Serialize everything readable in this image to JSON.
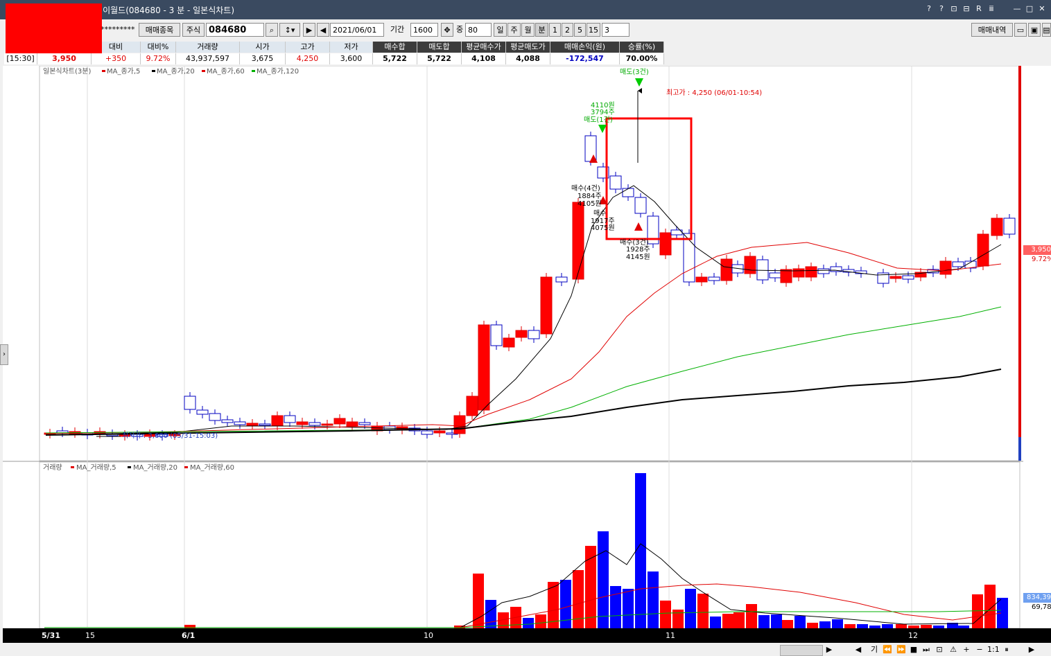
{
  "window": {
    "title": "[7450]매매복기차트 - 이월드(084680 - 3 분 - 일본식차트)",
    "buttons": [
      "?",
      "?",
      "⊡",
      "⊟",
      "R",
      "ⅲ",
      "—",
      "□",
      "✕"
    ]
  },
  "toolbar": {
    "account_mask": "*********",
    "trade_items_btn": "매매종목",
    "market_label": "주식",
    "code_value": "084680",
    "date_value": "2021/06/01",
    "period_label": "기간",
    "period_value": "1600",
    "mid_label": "중",
    "mid_value": "80",
    "timeframes": [
      "일",
      "주",
      "월",
      "분",
      "1",
      "2",
      "5",
      "15"
    ],
    "minute_value": "3",
    "history_btn": "매매내역"
  },
  "info_table": {
    "headers": [
      "대비",
      "대비%",
      "거래량",
      "시가",
      "고가",
      "저가",
      "매수합",
      "매도합",
      "평균매수가",
      "평균매도가",
      "매매손익(원)",
      "승률(%)"
    ],
    "time": "[15:30]",
    "price": "3,950",
    "values": [
      "+350",
      "9.72%",
      "43,937,597",
      "3,675",
      "4,250",
      "3,600",
      "5,722",
      "5,722",
      "4,108",
      "4,088",
      "-172,547",
      "70.00%"
    ]
  },
  "price_panel": {
    "legend_title": "일본식차트(3분)",
    "legend_items": [
      "MA_종가,5",
      "MA_종가,20",
      "MA_종가,60",
      "MA_종가,120"
    ],
    "high_label": "최고가 : 4,250 (06/01-10:54)",
    "low_label": "최저가 : 3,600 (05/31-15:03)",
    "price_tag": "3,950",
    "pct_tag": "9.72%",
    "annotations": {
      "sell_top": "매도(3건)",
      "a1": "4110원",
      "a2": "3794주",
      "a3": "매도(1건)",
      "b1": "매수(4건)",
      "b2": "1884주",
      "b3": "4105원",
      "c1": "매수",
      "c2": "1917주",
      "c3": "4075원",
      "d1": "매수(3건)",
      "d2": "1928주",
      "d3": "4145원"
    }
  },
  "volume_panel": {
    "legend_title": "거래량",
    "legend_items": [
      "MA_거래량,5",
      "MA_거래량,20",
      "MA_거래량,60"
    ],
    "tag1": "834,39",
    "tag2": "69,78"
  },
  "date_axis": [
    "5/31",
    "15",
    "6/1",
    "10",
    "11",
    "12"
  ],
  "scroll_buttons": [
    "◀",
    "▶",
    "기",
    "⏪",
    "⏩",
    "■",
    "⏭",
    "⊡",
    "⚠",
    "+",
    "−",
    "1:1",
    "⏸",
    "▶"
  ],
  "colors": {
    "up": "#ff0000",
    "down": "#0000ff",
    "ma5": "#000000",
    "ma20": "#e00000",
    "ma60": "#00b000",
    "ma120": "#000000",
    "sell_arrow": "#00cc00",
    "buy_arrow": "#e00000"
  }
}
